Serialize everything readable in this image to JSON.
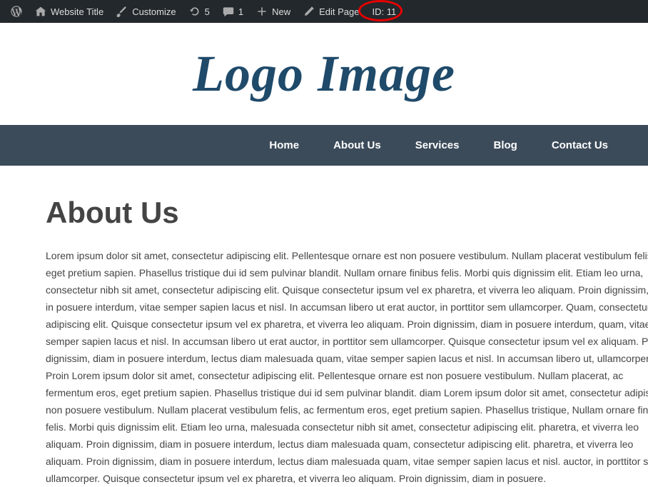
{
  "adminbar": {
    "site_title": "Website Title",
    "customize": "Customize",
    "updates_count": "5",
    "comments_count": "1",
    "new_label": "New",
    "edit_label": "Edit Page",
    "id_label": "ID: 11"
  },
  "logo": {
    "text": "Logo Image"
  },
  "nav": {
    "items": [
      "Home",
      "About Us",
      "Services",
      "Blog",
      "Contact Us"
    ]
  },
  "page": {
    "title": "About Us",
    "body": "Lorem ipsum dolor sit amet, consectetur adipiscing elit. Pellentesque ornare est non posuere vestibulum. Nullam placerat vestibulum felis, eget pretium sapien. Phasellus tristique dui id sem pulvinar blandit. Nullam ornare finibus felis. Morbi quis dignissim elit. Etiam leo urna, consectetur nibh sit amet, consectetur adipiscing elit. Quisque consectetur ipsum vel ex pharetra, et viverra leo aliquam. Proin dignissim, diam in posuere interdum, vitae semper sapien lacus et nisl. In accumsan libero ut erat auctor, in porttitor sem ullamcorper. Quam, consectetur adipiscing elit. Quisque consectetur ipsum vel ex pharetra, et viverra leo aliquam. Proin dignissim, diam in posuere interdum, quam, vitae semper sapien lacus et nisl. In accumsan libero ut erat auctor, in porttitor sem ullamcorper. Quisque consectetur ipsum vel ex aliquam. Proin dignissim, diam in posuere interdum, lectus diam malesuada quam, vitae semper sapien lacus et nisl. In accumsan libero ut, ullamcorper. Proin Lorem ipsum dolor sit amet, consectetur adipiscing elit. Pellentesque ornare est non posuere vestibulum. Nullam placerat, ac fermentum eros, eget pretium sapien. Phasellus tristique dui id sem pulvinar blandit. diam Lorem ipsum dolor sit amet, consectetur adipiscing, non posuere vestibulum. Nullam placerat vestibulum felis, ac fermentum eros, eget pretium sapien. Phasellus tristique, Nullam ornare finibus felis. Morbi quis dignissim elit. Etiam leo urna, malesuada consectetur nibh sit amet, consectetur adipiscing elit. pharetra, et viverra leo aliquam. Proin dignissim, diam in posuere interdum, lectus diam malesuada quam, consectetur adipiscing elit. pharetra, et viverra leo aliquam. Proin dignissim, diam in posuere interdum, lectus diam malesuada quam, vitae semper sapien lacus et nisl. auctor, in porttitor sem ullamcorper. Quisque consectetur ipsum vel ex pharetra, et viverra leo aliquam. Proin dignissim, diam in posuere."
  }
}
